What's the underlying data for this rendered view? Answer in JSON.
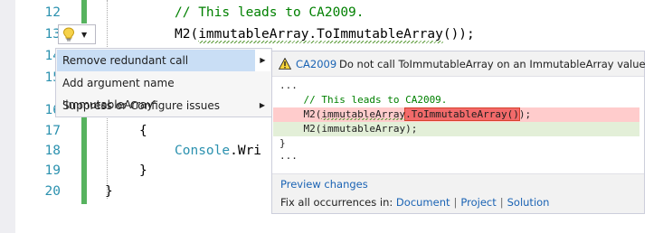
{
  "editor": {
    "line_numbers": [
      "12",
      "13",
      "14",
      "15",
      "16",
      "17",
      "18",
      "19",
      "20"
    ],
    "line12": {
      "comment": "// This leads to CA2009."
    },
    "line13": {
      "method": "M2",
      "paren_open": "(",
      "arg": "immutableArray",
      "dot": ".",
      "call": "ToImmutableArray",
      "paren_close": "());"
    },
    "line17": {
      "text": "{"
    },
    "line18": {
      "type": "Console",
      "rest": ".Wri"
    },
    "line19": {
      "text": "}"
    },
    "line20": {
      "text": "}"
    }
  },
  "lightbulb": {
    "icon": "lightbulb-icon",
    "chevron": "▼"
  },
  "menu": {
    "items": [
      {
        "label": "Remove redundant call",
        "has_submenu": true,
        "selected": true,
        "arrow": "▶"
      },
      {
        "label": "Add argument name 'immutableArray'",
        "has_submenu": false,
        "selected": false
      },
      {
        "label": "Suppress or Configure issues",
        "has_submenu": true,
        "selected": false,
        "arrow": "▶"
      }
    ]
  },
  "preview": {
    "diagnostic_id": "CA2009",
    "message": "Do not call ToImmutableArray on an ImmutableArray value",
    "lines": {
      "l1": "...",
      "l2": "    // This leads to CA2009.",
      "l3_prefix": "    M2(",
      "l3_arg": "immutableArray",
      "l3_removed": ".ToImmutableArray()",
      "l3_suffix": ");",
      "l4": "    M2(immutableArray);",
      "l5": "}",
      "l6": "..."
    },
    "preview_changes": "Preview changes",
    "fix_all_label": "Fix all occurrences in:",
    "fix_all_document": "Document",
    "fix_all_project": "Project",
    "fix_all_solution": "Solution",
    "separator": "|"
  },
  "colors": {
    "line_number": "#2b91af",
    "comment": "#008000",
    "link": "#1a63b4",
    "change_bar": "#57b35f",
    "removed_bg": "#ffcccc",
    "added_bg": "#e3efd8",
    "menu_selected": "#c9def5"
  }
}
